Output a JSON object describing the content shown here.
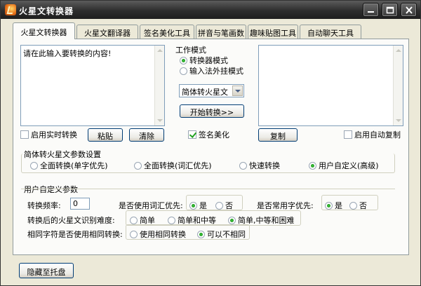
{
  "window": {
    "title": "火星文转换器"
  },
  "tabs": [
    {
      "label": "火星文转换器",
      "active": true
    },
    {
      "label": "火星文翻译器",
      "active": false
    },
    {
      "label": "签名美化工具",
      "active": false
    },
    {
      "label": "拼音与笔画数",
      "active": false
    },
    {
      "label": "趣味贴图工具",
      "active": false
    },
    {
      "label": "自动聊天工具",
      "active": false
    }
  ],
  "converter": {
    "input_text": "请在此输入要转换的内容!",
    "output_text": "",
    "mode_title": "工作模式",
    "mode_converter": "转换器模式",
    "mode_ime": "输入法外挂模式",
    "direction_select": "简体转火星文",
    "start_button": "开始转换>>",
    "realtime_check": "启用实时转换",
    "paste_button": "粘贴",
    "clear_button": "清除",
    "signature_check": "签名美化",
    "copy_button": "复制",
    "autocopy_check": "启用自动复制"
  },
  "params": {
    "title": "简体转火星文参数设置",
    "opt_single": "全面转换(单字优先)",
    "opt_vocab": "全面转换(词汇优先)",
    "opt_fast": "快速转换",
    "opt_custom": "用户自定义(高级)"
  },
  "custom": {
    "title": "用户自定义参数",
    "freq_label": "转换频率:",
    "freq_value": "0",
    "vocab_label": "是否使用词汇优先:",
    "vocab_yes": "是",
    "vocab_no": "否",
    "common_label": "是否常用字优先:",
    "common_yes": "是",
    "common_no": "否",
    "difficulty_label": "转换后的火星文识别难度:",
    "diff_easy": "简单",
    "diff_easy_mid": "简单和中等",
    "diff_all": "简单,中等和困难",
    "same_label": "相同字符是否使用相同转换:",
    "same_use": "使用相同转换",
    "same_any": "可以不相同"
  },
  "footer": {
    "tray_button": "隐藏至托盘"
  }
}
